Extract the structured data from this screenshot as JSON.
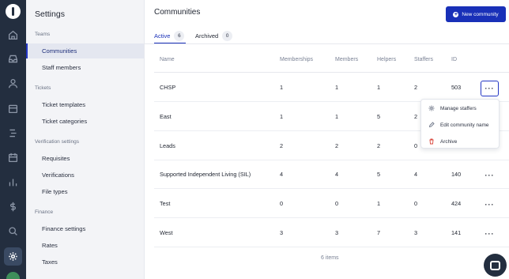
{
  "sidebar": {
    "title": "Settings",
    "sections": [
      {
        "label": "Teams",
        "items": [
          {
            "label": "Communities"
          },
          {
            "label": "Staff members"
          }
        ]
      },
      {
        "label": "Tickets",
        "items": [
          {
            "label": "Ticket templates"
          },
          {
            "label": "Ticket categories"
          }
        ]
      },
      {
        "label": "Verification settings",
        "items": [
          {
            "label": "Requisites"
          },
          {
            "label": "Verifications"
          },
          {
            "label": "File types"
          }
        ]
      },
      {
        "label": "Finance",
        "items": [
          {
            "label": "Finance settings"
          },
          {
            "label": "Rates"
          },
          {
            "label": "Taxes"
          }
        ]
      }
    ],
    "active_item": "Communities"
  },
  "rail": {
    "icons": [
      "home-icon",
      "inbox-icon",
      "user-icon",
      "store-icon",
      "flow-icon",
      "calendar-icon",
      "chart-icon",
      "dollar-icon",
      "search-icon",
      "gear-icon"
    ],
    "active_icon": "gear-icon"
  },
  "main": {
    "title": "Communities",
    "new_button": "New community",
    "tabs": [
      {
        "label": "Active",
        "count": "6"
      },
      {
        "label": "Archived",
        "count": "0"
      }
    ],
    "columns": [
      "Name",
      "Memberships",
      "Members",
      "Helpers",
      "Staffers",
      "ID"
    ],
    "rows": [
      {
        "name": "CHSP",
        "memberships": "1",
        "members": "1",
        "helpers": "1",
        "staffers": "2",
        "id": "503"
      },
      {
        "name": "East",
        "memberships": "1",
        "members": "1",
        "helpers": "5",
        "staffers": "2",
        "id": ""
      },
      {
        "name": "Leads",
        "memberships": "2",
        "members": "2",
        "helpers": "2",
        "staffers": "0",
        "id": ""
      },
      {
        "name": "Supported Independent Living (SIL)",
        "memberships": "4",
        "members": "4",
        "helpers": "5",
        "staffers": "4",
        "id": "140"
      },
      {
        "name": "Test",
        "memberships": "0",
        "members": "0",
        "helpers": "1",
        "staffers": "0",
        "id": "424"
      },
      {
        "name": "West",
        "memberships": "3",
        "members": "3",
        "helpers": "7",
        "staffers": "3",
        "id": "141"
      }
    ],
    "footer": "6 items"
  },
  "row_menu": {
    "items": [
      {
        "label": "Manage staffers",
        "icon": "gear-icon"
      },
      {
        "label": "Edit community name",
        "icon": "pencil-icon"
      },
      {
        "label": "Archive",
        "icon": "trash-icon"
      }
    ]
  },
  "colors": {
    "primary": "#1930b8",
    "rail": "#232e3f",
    "danger": "#d9453b"
  }
}
